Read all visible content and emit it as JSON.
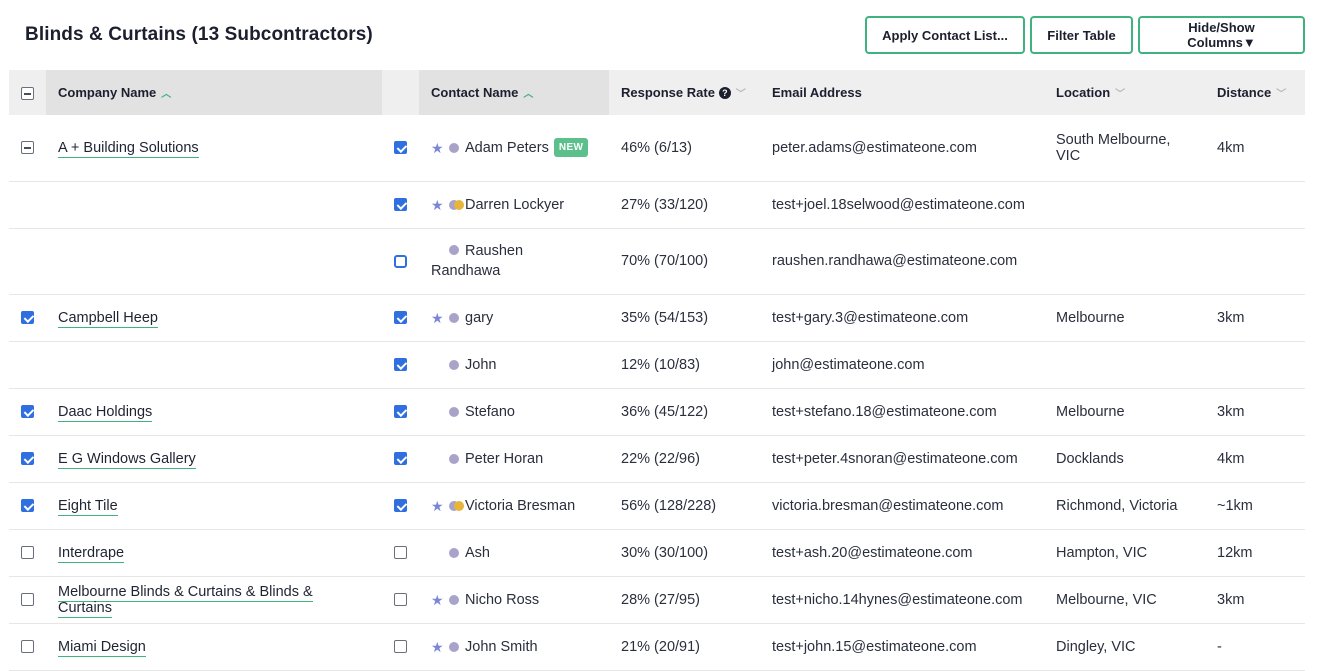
{
  "title": "Blinds & Curtains (13 Subcontractors)",
  "toolbar": {
    "apply_contact_list": "Apply Contact List...",
    "filter_table": "Filter Table",
    "hide_show_columns": "Hide/Show Columns▼"
  },
  "columns": {
    "company": "Company Name",
    "contact": "Contact Name",
    "response_rate": "Response Rate",
    "email": "Email Address",
    "location": "Location",
    "distance": "Distance"
  },
  "rows": [
    {
      "company_checkbox": "mixed",
      "company": "A + Building Solutions",
      "contact_checked": true,
      "starred": true,
      "dot2": false,
      "contact": "Adam Peters",
      "badge": "NEW",
      "rate": "46% (6/13)",
      "email": "peter.adams@estimateone.com",
      "location": "South Melbourne, VIC",
      "distance": "4km"
    },
    {
      "company_checkbox": "none",
      "company": "",
      "contact_checked": true,
      "starred": true,
      "dot2": true,
      "contact": "Darren Lockyer",
      "badge": "",
      "rate": "27% (33/120)",
      "email": "test+joel.18selwood@estimateone.com",
      "location": "",
      "distance": ""
    },
    {
      "company_checkbox": "none",
      "company": "",
      "contact_checked": false,
      "focus": true,
      "starred": false,
      "dot2": false,
      "contact": "Raushen Randhawa",
      "contact_line1": "Raushen",
      "contact_line2": "Randhawa",
      "badge": "",
      "rate": "70% (70/100)",
      "email": "raushen.randhawa@estimateone.com",
      "location": "",
      "distance": ""
    },
    {
      "company_checkbox": "checked",
      "company": "Campbell Heep",
      "contact_checked": true,
      "starred": true,
      "dot2": false,
      "contact": "gary",
      "badge": "",
      "rate": "35% (54/153)",
      "email": "test+gary.3@estimateone.com",
      "location": "Melbourne",
      "distance": "3km"
    },
    {
      "company_checkbox": "none",
      "company": "",
      "contact_checked": true,
      "starred": false,
      "dot2": false,
      "contact": "John",
      "badge": "",
      "rate": "12% (10/83)",
      "email": "john@estimateone.com",
      "location": "",
      "distance": ""
    },
    {
      "company_checkbox": "checked",
      "company": "Daac Holdings",
      "contact_checked": true,
      "starred": false,
      "dot2": false,
      "contact": "Stefano",
      "badge": "",
      "rate": "36% (45/122)",
      "email": "test+stefano.18@estimateone.com",
      "location": "Melbourne",
      "distance": "3km"
    },
    {
      "company_checkbox": "checked",
      "company": "E G Windows Gallery",
      "contact_checked": true,
      "starred": false,
      "dot2": false,
      "contact": "Peter Horan",
      "badge": "",
      "rate": "22% (22/96)",
      "email": "test+peter.4snoran@estimateone.com",
      "location": "Docklands",
      "distance": "4km"
    },
    {
      "company_checkbox": "checked",
      "company": "Eight Tile",
      "contact_checked": true,
      "starred": true,
      "dot2": true,
      "contact": "Victoria Bresman",
      "badge": "",
      "rate": "56% (128/228)",
      "email": "victoria.bresman@estimateone.com",
      "location": "Richmond, Victoria",
      "distance": "~1km"
    },
    {
      "company_checkbox": "unchecked",
      "company": "Interdrape",
      "contact_checked": false,
      "starred": false,
      "dot2": false,
      "contact": "Ash",
      "badge": "",
      "rate": "30% (30/100)",
      "email": "test+ash.20@estimateone.com",
      "location": "Hampton, VIC",
      "distance": "12km"
    },
    {
      "company_checkbox": "unchecked",
      "company": "Melbourne Blinds & Curtains & Blinds & Curtains",
      "contact_checked": false,
      "starred": true,
      "dot2": false,
      "contact": "Nicho Ross",
      "badge": "",
      "rate": "28% (27/95)",
      "email": "test+nicho.14hynes@estimateone.com",
      "location": "Melbourne, VIC",
      "distance": "3km"
    },
    {
      "company_checkbox": "unchecked",
      "company": "Miami Design",
      "contact_checked": false,
      "starred": true,
      "dot2": false,
      "contact": "John Smith",
      "badge": "",
      "rate": "21% (20/91)",
      "email": "test+john.15@estimateone.com",
      "location": "Dingley, VIC",
      "distance": "-"
    }
  ],
  "colors": {
    "accent_green": "#3fb27f",
    "checkbox_blue": "#2f6fe0",
    "star": "#7b86d8",
    "dot_purple": "#a7a3c9",
    "dot_yellow": "#e6b53a",
    "new_badge": "#5cc08c"
  }
}
